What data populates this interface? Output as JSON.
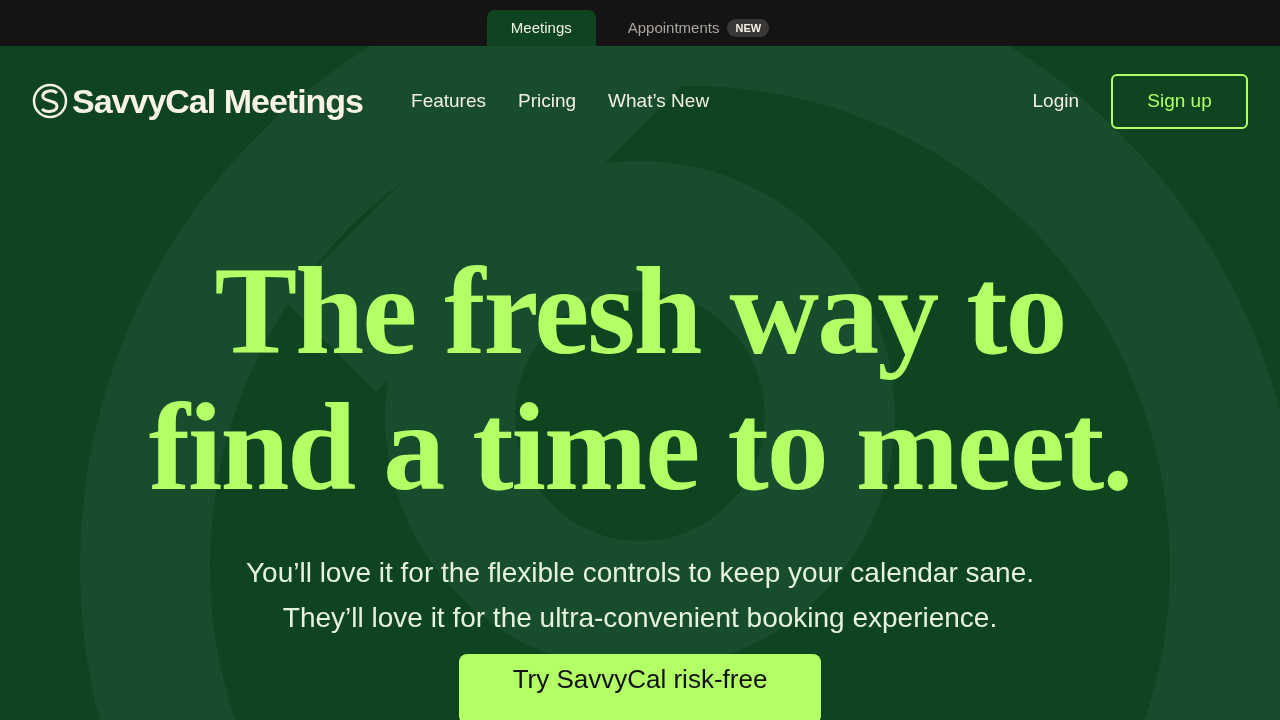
{
  "top_tabs": [
    {
      "label": "Meetings",
      "selected": true
    },
    {
      "label": "Appointments",
      "selected": false,
      "badge": "NEW"
    }
  ],
  "nav": {
    "logo": "SavvyCal Meetings",
    "links": [
      "Features",
      "Pricing",
      "What’s New"
    ],
    "login": "Login",
    "signup": "Sign up"
  },
  "hero": {
    "headline": [
      "The fresh way to",
      "find a time to meet."
    ],
    "subtitle": [
      "You’ll love it for the flexible controls to keep your calendar sane.",
      "They’ll love it for the ultra-convenient booking experience."
    ],
    "cta": "Try SavvyCal risk-free"
  }
}
